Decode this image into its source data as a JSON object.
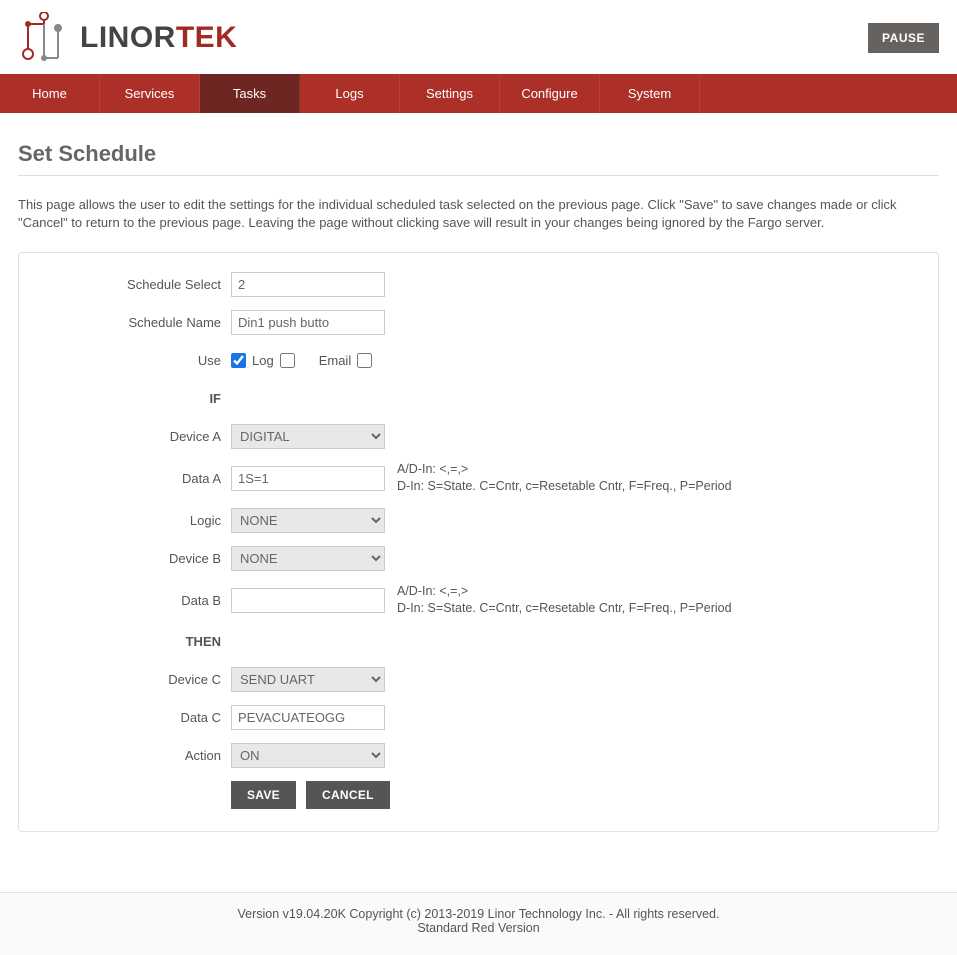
{
  "header": {
    "brand_prefix": "LINOR",
    "brand_suffix": "TEK",
    "pause_label": "PAUSE"
  },
  "nav": {
    "items": [
      "Home",
      "Services",
      "Tasks",
      "Logs",
      "Settings",
      "Configure",
      "System"
    ],
    "active_index": 2
  },
  "page": {
    "title": "Set Schedule",
    "intro": "This page allows the user to edit the settings for the individual scheduled task selected on the previous page. Click \"Save\" to save changes made or click \"Cancel\" to return to the previous page. Leaving the page without clicking save will result in your changes being ignored by the Fargo server."
  },
  "form": {
    "schedule_select_label": "Schedule Select",
    "schedule_select_value": "2",
    "schedule_name_label": "Schedule Name",
    "schedule_name_value": "Din1 push butto",
    "use_label": "Use",
    "use_checked": true,
    "log_label": "Log",
    "log_checked": false,
    "email_label": "Email",
    "email_checked": false,
    "if_label": "IF",
    "device_a_label": "Device A",
    "device_a_value": "DIGITAL",
    "data_a_label": "Data A",
    "data_a_value": "1S=1",
    "logic_label": "Logic",
    "logic_value": "NONE",
    "device_b_label": "Device B",
    "device_b_value": "NONE",
    "data_b_label": "Data B",
    "data_b_value": "",
    "then_label": "THEN",
    "device_c_label": "Device C",
    "device_c_value": "SEND UART",
    "data_c_label": "Data C",
    "data_c_value": "PEVACUATEOGG",
    "action_label": "Action",
    "action_value": "ON",
    "hint_line1": "A/D-In: <,=,>",
    "hint_line2": "D-In: S=State. C=Cntr, c=Resetable Cntr, F=Freq., P=Period",
    "save_label": "SAVE",
    "cancel_label": "CANCEL"
  },
  "footer": {
    "line1": "Version v19.04.20K Copyright (c) 2013-2019 Linor Technology Inc. - All rights reserved.",
    "line2": "Standard Red Version"
  }
}
